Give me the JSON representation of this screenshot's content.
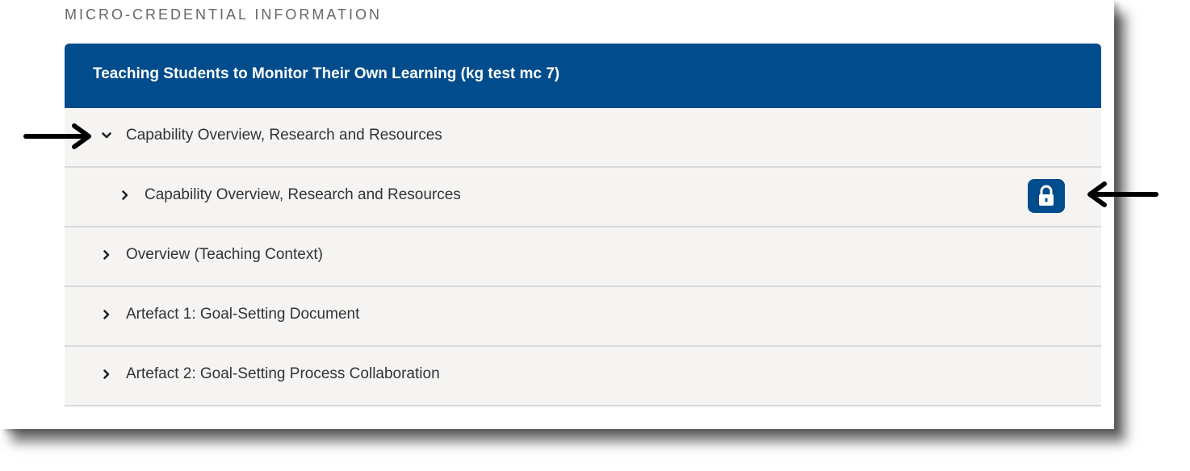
{
  "section_heading": "MICRO-CREDENTIAL INFORMATION",
  "header": {
    "title": "Teaching Students to Monitor Their Own Learning (kg test mc 7)"
  },
  "rows": [
    {
      "label": "Capability Overview, Research and Resources",
      "state": "expanded",
      "icon": "chevron-down-icon"
    },
    {
      "label": "Capability Overview, Research and Resources",
      "state": "collapsed",
      "icon": "chevron-right-icon",
      "lock_icon": "lock-icon"
    },
    {
      "label": "Overview (Teaching Context)",
      "state": "collapsed",
      "icon": "chevron-right-icon"
    },
    {
      "label": "Artefact 1: Goal-Setting Document",
      "state": "collapsed",
      "icon": "chevron-right-icon"
    },
    {
      "label": "Artefact 2: Goal-Setting Process Collaboration",
      "state": "collapsed",
      "icon": "chevron-right-icon"
    }
  ],
  "annotations": [
    "arrow-right-icon",
    "arrow-left-icon"
  ],
  "colors": {
    "header_bg": "#004c8c",
    "row_bg": "#f5f4f3",
    "lock_button_bg": "#004c8c"
  }
}
